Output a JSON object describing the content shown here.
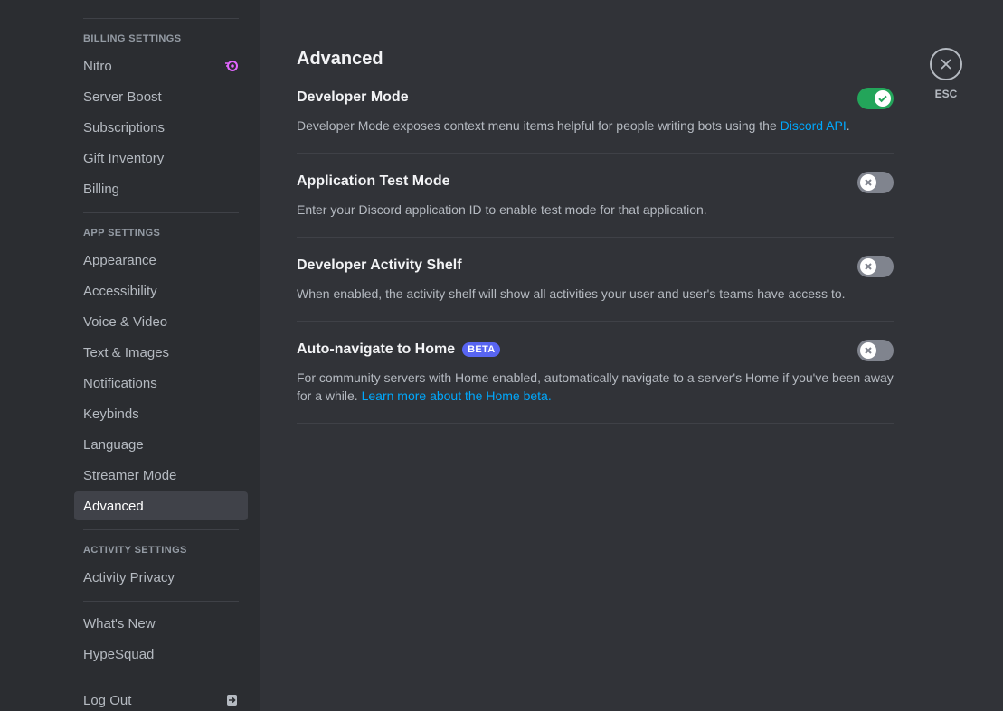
{
  "sidebar": {
    "sections": [
      {
        "header": "Billing Settings",
        "items": [
          "Nitro",
          "Server Boost",
          "Subscriptions",
          "Gift Inventory",
          "Billing"
        ]
      },
      {
        "header": "App Settings",
        "items": [
          "Appearance",
          "Accessibility",
          "Voice & Video",
          "Text & Images",
          "Notifications",
          "Keybinds",
          "Language",
          "Streamer Mode",
          "Advanced"
        ]
      },
      {
        "header": "Activity Settings",
        "items": [
          "Activity Privacy"
        ]
      }
    ],
    "extra_items": [
      "What's New",
      "HypeSquad"
    ],
    "logout": "Log Out",
    "selected": "Advanced",
    "nitro_icon": "nitro-icon",
    "logout_icon": "logout-icon"
  },
  "page": {
    "title": "Advanced",
    "settings": [
      {
        "title": "Developer Mode",
        "desc": "Developer Mode exposes context menu items helpful for people writing bots using the ",
        "link": "Discord API",
        "desc_after": ".",
        "enabled": true
      },
      {
        "title": "Application Test Mode",
        "desc": "Enter your Discord application ID to enable test mode for that application.",
        "enabled": false
      },
      {
        "title": "Developer Activity Shelf",
        "desc": "When enabled, the activity shelf will show all activities your user and user's teams have access to.",
        "enabled": false
      },
      {
        "title": "Auto-navigate to Home",
        "badge": "BETA",
        "desc": "For community servers with Home enabled, automatically navigate to a server's Home if you've been away for a while. ",
        "link": "Learn more about the Home beta.",
        "enabled": false
      }
    ]
  },
  "esc": {
    "label": "ESC",
    "icon": "close-icon"
  },
  "colors": {
    "toggle_on": "#23a55a",
    "toggle_off": "#80848e",
    "link": "#00a8fc",
    "beta": "#5865f2",
    "selected_bg": "#404249"
  }
}
